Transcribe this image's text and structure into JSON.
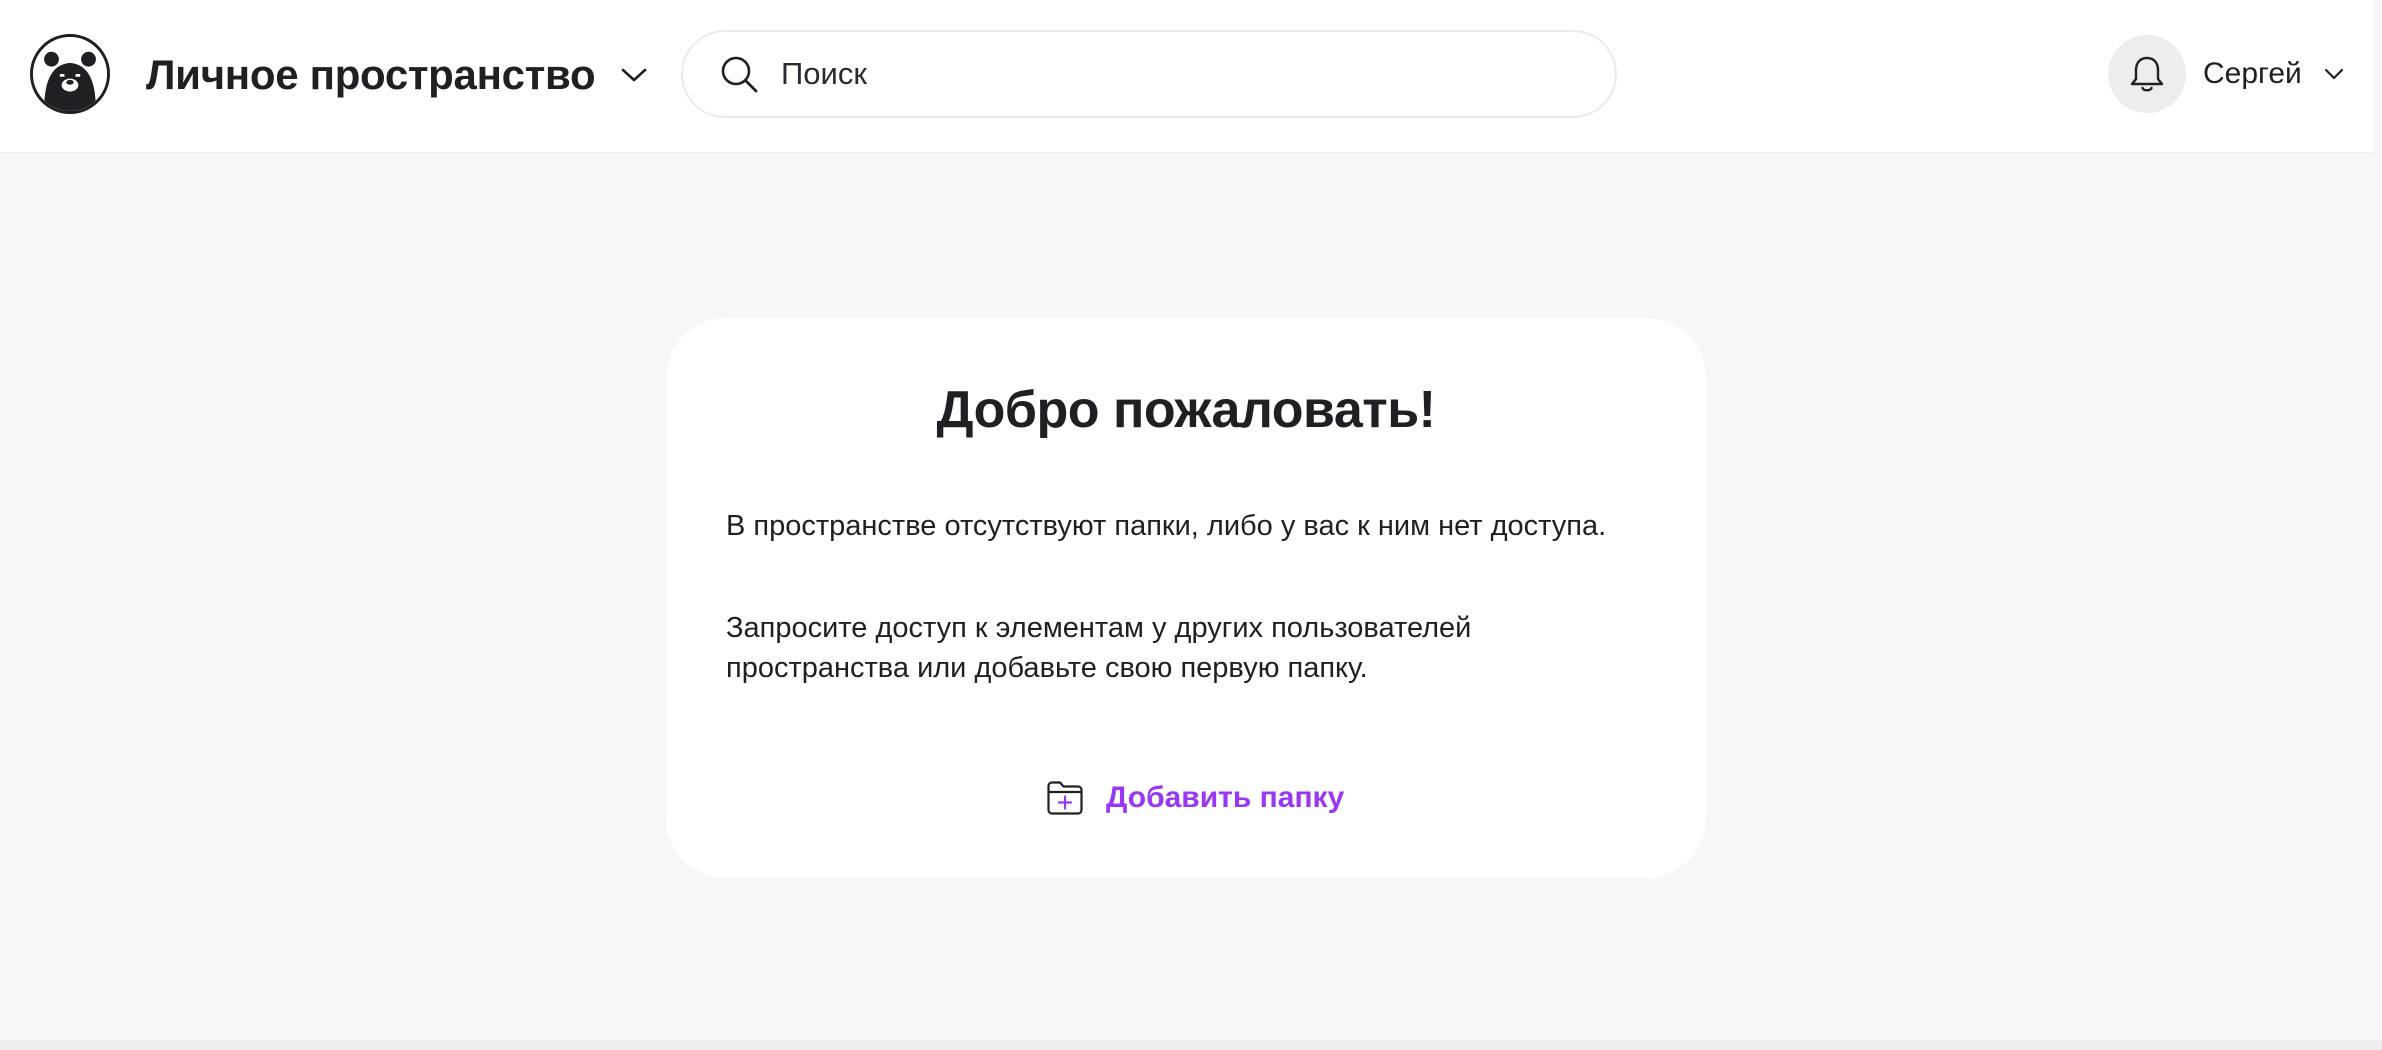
{
  "header": {
    "logo_icon": "bear-logo-icon",
    "space_title": "Личное пространство",
    "space_chevron_icon": "chevron-down-icon",
    "search": {
      "icon": "search-icon",
      "value": "",
      "placeholder": "Поиск"
    },
    "notifications_icon": "bell-icon",
    "user": {
      "name": "Сергей",
      "chevron_icon": "chevron-down-icon"
    }
  },
  "welcome_card": {
    "title": "Добро пожаловать!",
    "message_1": "В пространстве отсутствуют папки, либо у вас к ним нет доступа.",
    "message_2": "Запросите доступ к элементам у других пользователей пространства или добавьте свою первую папку.",
    "add_folder": {
      "icon": "folder-plus-icon",
      "label": "Добавить папку"
    }
  },
  "colors": {
    "accent": "#9a36f4",
    "background": "#f7f7f9",
    "surface": "#ffffff",
    "text": "#1f1f24"
  }
}
